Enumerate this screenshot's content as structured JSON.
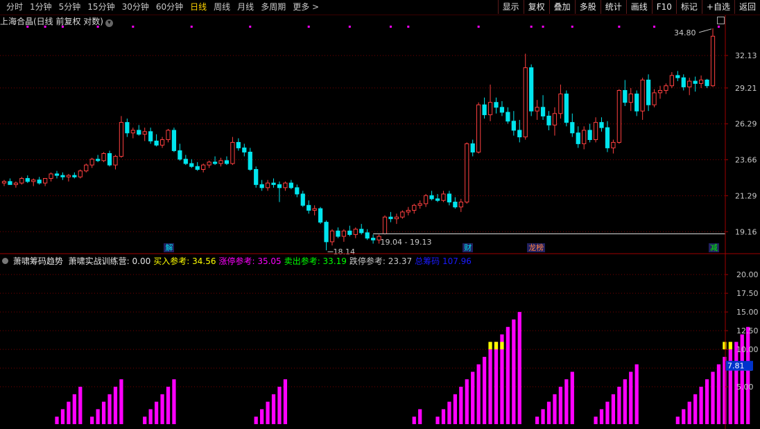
{
  "toolbar": {
    "tabs": [
      "分时",
      "1分钟",
      "5分钟",
      "15分钟",
      "30分钟",
      "60分钟",
      "日线",
      "周线",
      "月线",
      "多周期",
      "更多 >"
    ],
    "active_tab": "日线",
    "right_buttons": [
      "显示",
      "复权",
      "叠加",
      "多股",
      "统计",
      "画线",
      "F10",
      "标记",
      "+自选",
      "返回"
    ]
  },
  "chart_title": "上海合晶(日线 前复权 对数)",
  "colors": {
    "up": "#ff4040",
    "down": "#00e5ee",
    "grid": "#7a0000",
    "magenta": "#ff00ff",
    "yellow": "#ffff00",
    "indicator_value_bg": "#0033cc"
  },
  "price_axis": {
    "ticks": [
      "32.13",
      "29.21",
      "26.29",
      "23.66",
      "21.29",
      "19.16"
    ],
    "high_label": "34.80",
    "low_label": "18.14",
    "range_label": "19.04 - 19.13"
  },
  "events": [
    {
      "label": "解",
      "color": "#00e5ee"
    },
    {
      "label": "财",
      "color": "#00e5ee"
    },
    {
      "label": "龙虎榜",
      "short": "龙榜",
      "color": "#ff8040"
    },
    {
      "label": "减",
      "color": "#00ff00"
    }
  ],
  "indicator": {
    "name": "萧啸筹码趋势",
    "items": [
      {
        "label": "萧啸实战训练营:",
        "value": "0.00",
        "color": "#e6e6e6"
      },
      {
        "label": "买入参考:",
        "value": "34.56",
        "color": "#ffff00"
      },
      {
        "label": "涨停参考:",
        "value": "35.05",
        "color": "#ff00ff"
      },
      {
        "label": "卖出参考:",
        "value": "33.19",
        "color": "#00ff00"
      },
      {
        "label": "跌停参考:",
        "value": "23.37",
        "color": "#c8c8c8"
      },
      {
        "label": "总筹码",
        "value": "107.96",
        "color": "#1a1aff"
      }
    ],
    "axis_ticks": [
      "20.00",
      "17.50",
      "15.00",
      "12.50",
      "10.00",
      "7.50",
      "5.00"
    ],
    "current_value": "7.81"
  },
  "chart_data": {
    "type": "candlestick",
    "candles": [
      [
        22.1,
        22.3,
        21.9,
        22.2
      ],
      [
        22.2,
        22.4,
        22.0,
        22.0
      ],
      [
        22.0,
        22.2,
        21.8,
        22.1
      ],
      [
        22.1,
        22.5,
        22.0,
        22.4
      ],
      [
        22.4,
        22.6,
        22.1,
        22.2
      ],
      [
        22.2,
        22.4,
        21.9,
        22.3
      ],
      [
        22.3,
        22.5,
        22.0,
        22.1
      ],
      [
        22.1,
        22.3,
        21.9,
        22.4
      ],
      [
        22.4,
        22.8,
        22.2,
        22.7
      ],
      [
        22.7,
        22.9,
        22.4,
        22.6
      ],
      [
        22.6,
        22.8,
        22.3,
        22.5
      ],
      [
        22.5,
        22.7,
        22.2,
        22.6
      ],
      [
        22.6,
        22.8,
        22.4,
        22.5
      ],
      [
        22.5,
        23.0,
        22.4,
        22.9
      ],
      [
        22.9,
        23.4,
        22.8,
        23.3
      ],
      [
        23.3,
        23.8,
        23.1,
        23.7
      ],
      [
        23.7,
        24.0,
        23.5,
        23.6
      ],
      [
        23.6,
        24.2,
        23.5,
        24.1
      ],
      [
        24.1,
        24.3,
        23.2,
        23.3
      ],
      [
        23.3,
        24.0,
        23.0,
        23.9
      ],
      [
        23.9,
        26.9,
        23.8,
        26.4
      ],
      [
        26.4,
        26.7,
        25.3,
        25.6
      ],
      [
        25.6,
        26.0,
        25.2,
        25.8
      ],
      [
        25.8,
        26.2,
        25.4,
        25.5
      ],
      [
        25.5,
        26.0,
        25.0,
        25.7
      ],
      [
        25.7,
        26.0,
        24.8,
        25.0
      ],
      [
        25.0,
        25.5,
        24.6,
        24.7
      ],
      [
        24.7,
        25.3,
        24.5,
        25.1
      ],
      [
        25.1,
        25.9,
        24.9,
        25.8
      ],
      [
        25.8,
        26.0,
        24.2,
        24.3
      ],
      [
        24.3,
        24.8,
        23.6,
        23.7
      ],
      [
        23.7,
        24.0,
        23.3,
        23.4
      ],
      [
        23.4,
        23.7,
        23.1,
        23.2
      ],
      [
        23.2,
        23.5,
        22.9,
        23.0
      ],
      [
        23.0,
        23.4,
        22.8,
        23.3
      ],
      [
        23.3,
        23.6,
        23.1,
        23.5
      ],
      [
        23.5,
        23.9,
        23.3,
        23.4
      ],
      [
        23.4,
        23.8,
        23.2,
        23.6
      ],
      [
        23.6,
        23.9,
        23.3,
        23.4
      ],
      [
        23.4,
        25.3,
        23.3,
        24.9
      ],
      [
        24.9,
        25.2,
        24.3,
        24.5
      ],
      [
        24.5,
        24.8,
        23.9,
        24.2
      ],
      [
        24.2,
        24.5,
        22.9,
        23.0
      ],
      [
        23.0,
        23.2,
        21.8,
        22.0
      ],
      [
        22.0,
        22.3,
        21.6,
        21.8
      ],
      [
        21.8,
        22.3,
        21.6,
        22.1
      ],
      [
        22.1,
        22.4,
        21.8,
        22.0
      ],
      [
        22.0,
        22.2,
        20.9,
        21.8
      ],
      [
        21.8,
        22.2,
        21.6,
        22.1
      ],
      [
        22.1,
        22.3,
        21.7,
        21.8
      ],
      [
        21.8,
        22.0,
        21.2,
        21.4
      ],
      [
        21.4,
        21.6,
        20.6,
        20.7
      ],
      [
        20.7,
        21.0,
        20.2,
        20.4
      ],
      [
        20.4,
        20.7,
        20.1,
        20.5
      ],
      [
        20.5,
        20.6,
        19.6,
        19.7
      ],
      [
        19.7,
        19.8,
        18.14,
        18.6
      ],
      [
        18.6,
        19.3,
        18.4,
        19.2
      ],
      [
        19.2,
        19.4,
        18.8,
        18.9
      ],
      [
        18.9,
        19.3,
        18.6,
        19.2
      ],
      [
        19.2,
        19.5,
        18.9,
        19.0
      ],
      [
        19.0,
        19.4,
        18.8,
        19.3
      ],
      [
        19.3,
        19.6,
        19.0,
        19.1
      ],
      [
        19.1,
        19.3,
        18.7,
        18.8
      ],
      [
        18.8,
        19.0,
        18.5,
        18.7
      ],
      [
        18.7,
        19.0,
        18.5,
        18.9
      ],
      [
        19.04,
        20.1,
        19.0,
        20.0
      ],
      [
        20.0,
        20.3,
        19.7,
        19.9
      ],
      [
        19.9,
        20.2,
        19.6,
        20.0
      ],
      [
        20.0,
        20.4,
        19.9,
        20.3
      ],
      [
        20.3,
        20.6,
        20.1,
        20.4
      ],
      [
        20.4,
        20.8,
        20.2,
        20.7
      ],
      [
        20.7,
        21.0,
        20.5,
        20.8
      ],
      [
        20.8,
        21.4,
        20.6,
        21.3
      ],
      [
        21.3,
        21.6,
        21.0,
        21.1
      ],
      [
        21.1,
        21.4,
        20.9,
        21.0
      ],
      [
        21.0,
        21.6,
        20.9,
        21.4
      ],
      [
        21.4,
        21.6,
        20.7,
        20.9
      ],
      [
        20.9,
        21.2,
        20.5,
        20.6
      ],
      [
        20.6,
        21.1,
        20.3,
        20.9
      ],
      [
        20.9,
        24.9,
        20.8,
        24.8
      ],
      [
        24.8,
        25.1,
        23.9,
        24.2
      ],
      [
        24.2,
        28.0,
        24.1,
        27.8
      ],
      [
        27.8,
        28.4,
        26.7,
        27.0
      ],
      [
        27.0,
        29.5,
        26.5,
        28.0
      ],
      [
        28.0,
        28.4,
        27.1,
        27.6
      ],
      [
        27.6,
        28.1,
        26.9,
        27.2
      ],
      [
        27.2,
        27.6,
        26.3,
        26.5
      ],
      [
        26.5,
        27.3,
        25.4,
        25.8
      ],
      [
        25.8,
        26.6,
        24.9,
        25.3
      ],
      [
        25.3,
        32.3,
        25.1,
        31.0
      ],
      [
        31.0,
        31.3,
        26.9,
        27.3
      ],
      [
        27.3,
        28.2,
        26.6,
        27.6
      ],
      [
        27.6,
        28.6,
        26.6,
        26.9
      ],
      [
        26.9,
        27.3,
        25.8,
        26.2
      ],
      [
        26.2,
        27.6,
        25.4,
        27.1
      ],
      [
        27.1,
        29.5,
        26.7,
        28.7
      ],
      [
        28.7,
        29.0,
        26.1,
        26.4
      ],
      [
        26.4,
        27.1,
        25.3,
        25.6
      ],
      [
        25.6,
        26.1,
        24.5,
        24.8
      ],
      [
        24.8,
        26.1,
        24.4,
        25.8
      ],
      [
        25.8,
        26.3,
        24.9,
        25.1
      ],
      [
        25.1,
        26.8,
        24.9,
        26.4
      ],
      [
        26.4,
        26.8,
        25.7,
        26.0
      ],
      [
        26.0,
        26.5,
        24.2,
        24.5
      ],
      [
        24.5,
        25.1,
        24.1,
        24.9
      ],
      [
        24.9,
        29.1,
        24.8,
        29.0
      ],
      [
        29.0,
        29.9,
        27.7,
        28.0
      ],
      [
        28.0,
        29.2,
        27.3,
        28.7
      ],
      [
        28.7,
        29.0,
        26.9,
        27.3
      ],
      [
        27.3,
        30.1,
        26.6,
        29.9
      ],
      [
        29.9,
        30.4,
        27.3,
        27.8
      ],
      [
        27.8,
        29.1,
        27.6,
        28.8
      ],
      [
        28.8,
        29.4,
        28.3,
        29.0
      ],
      [
        29.0,
        29.6,
        28.7,
        29.4
      ],
      [
        29.4,
        30.6,
        29.2,
        30.3
      ],
      [
        30.3,
        30.7,
        29.8,
        30.1
      ],
      [
        30.1,
        30.4,
        29.0,
        29.3
      ],
      [
        29.3,
        30.1,
        28.6,
        29.8
      ],
      [
        29.8,
        30.2,
        28.9,
        29.6
      ],
      [
        29.6,
        30.3,
        29.2,
        29.9
      ],
      [
        29.9,
        30.0,
        29.2,
        29.4
      ],
      [
        29.4,
        34.8,
        29.3,
        34.0
      ]
    ],
    "indicator_bars": [
      {
        "start": 9,
        "values": [
          1,
          2,
          3,
          4,
          5
        ]
      },
      {
        "start": 15,
        "values": [
          1,
          2,
          3,
          4,
          5,
          6
        ]
      },
      {
        "start": 24,
        "values": [
          1,
          2,
          3,
          4,
          5,
          6
        ]
      },
      {
        "start": 43,
        "values": [
          1,
          2,
          3,
          4,
          5,
          6
        ]
      },
      {
        "start": 70,
        "values": [
          1,
          2
        ]
      },
      {
        "start": 74,
        "values": [
          1,
          2,
          3,
          4,
          5,
          6,
          7,
          8,
          9,
          10,
          11,
          12,
          13,
          14,
          15
        ]
      },
      {
        "start": 91,
        "values": [
          1,
          2,
          3,
          4,
          5,
          6,
          7
        ]
      },
      {
        "start": 101,
        "values": [
          1,
          2,
          3,
          4,
          5,
          6,
          7,
          8
        ]
      },
      {
        "start": 115,
        "values": [
          1,
          2,
          3,
          4,
          5,
          6,
          7,
          8,
          9,
          10,
          11,
          12,
          13
        ]
      }
    ],
    "yellow_caps": [
      [
        83,
        84,
        85
      ],
      [
        123,
        124
      ]
    ],
    "price_ylim": [
      18.0,
      35.0
    ],
    "indicator_ylim": [
      0,
      21.5
    ]
  }
}
